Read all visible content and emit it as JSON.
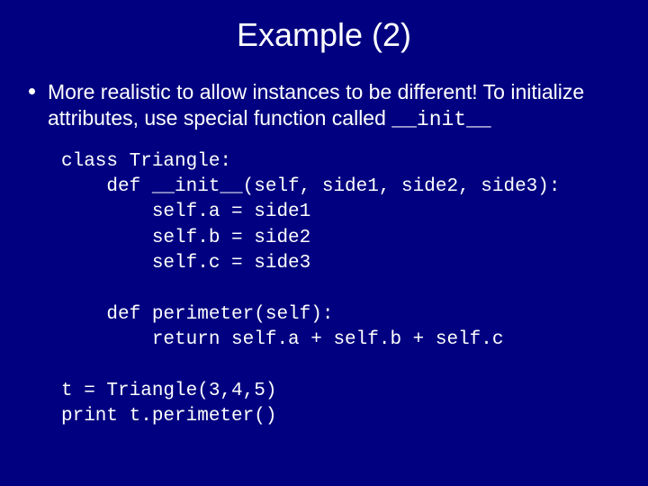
{
  "title": "Example (2)",
  "bullet": {
    "textBefore": "More realistic to allow instances to be different!  To initialize attributes, use special function called ",
    "codeInline": "__init__"
  },
  "code": "class Triangle:\n    def __init__(self, side1, side2, side3):\n        self.a = side1\n        self.b = side2\n        self.c = side3\n\n    def perimeter(self):\n        return self.a + self.b + self.c\n\nt = Triangle(3,4,5)\nprint t.perimeter()"
}
